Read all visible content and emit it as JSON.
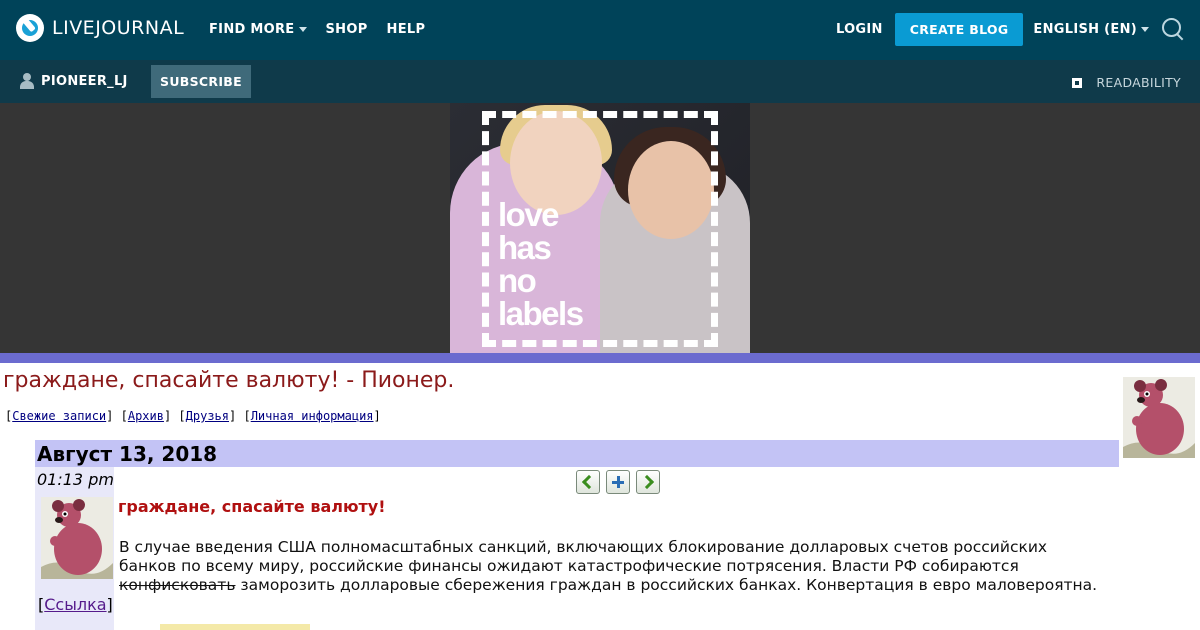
{
  "topbar": {
    "brand": "LIVEJOURNAL",
    "nav_left": [
      "FIND MORE",
      "SHOP",
      "HELP"
    ],
    "login": "LOGIN",
    "create_blog": "CREATE BLOG",
    "language": "ENGLISH (EN)",
    "search_icon": "search-icon"
  },
  "subbar": {
    "username": "PIONEER_LJ",
    "subscribe": "SUBSCRIBE",
    "readability": "READABILITY"
  },
  "banner": {
    "ad_text_lines": [
      "love",
      "has",
      "no",
      "labels"
    ]
  },
  "journal": {
    "title": "граждане, спасайте валюту! - Пионер.",
    "nav_links": [
      "Свежие записи",
      "Архив",
      "Друзья",
      "Личная информация"
    ]
  },
  "entry": {
    "date": "Август 13, 2018",
    "time": "01:13 pm",
    "link_label": "Ссылка",
    "subject": "граждане, спасайте валюту!",
    "body_before": "В случае введения США полномасштабных санкций, включающих блокирование долларовых счетов российских банков по всему миру, российские финансы ожидают катастрофические потрясения. Власти РФ собираются ",
    "body_strike": "конфисковать",
    "body_after": " заморозить долларовые сбережения граждан в российских банках. Конвертация в евро маловероятна."
  },
  "colors": {
    "topbar_bg": "#004359",
    "subbar_bg": "#0f3a4a",
    "accent_button": "#0a9bd3",
    "date_bar": "#c3c3f5",
    "title_red": "#8b1a1a"
  }
}
